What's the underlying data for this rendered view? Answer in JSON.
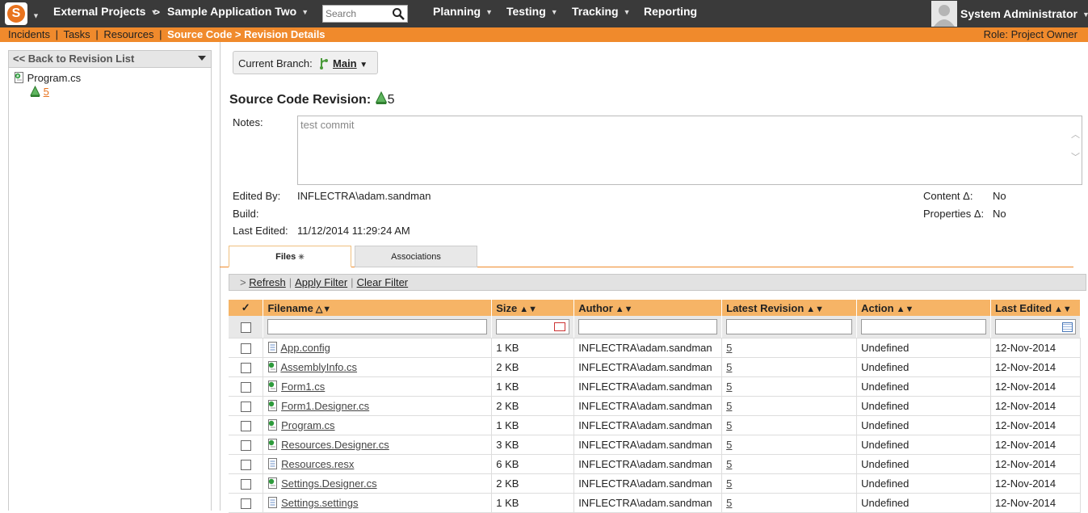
{
  "topnav": {
    "project_label": "External Projects",
    "separator": ">",
    "app_label": "Sample Application Two",
    "search_placeholder": "Search",
    "menus": [
      "Planning",
      "Testing",
      "Tracking",
      "Reporting"
    ],
    "user": "System Administrator"
  },
  "subnav": {
    "links": [
      "Incidents",
      "Tasks",
      "Resources"
    ],
    "current": "Source Code > Revision Details",
    "role": "Role: Project Owner"
  },
  "left": {
    "back_label": "<< Back to Revision List",
    "tree_file": "Program.cs",
    "tree_revision": "5"
  },
  "branch": {
    "label": "Current Branch:",
    "value": "Main"
  },
  "revision": {
    "heading": "Source Code Revision:",
    "number": "5",
    "notes_label": "Notes:",
    "notes_value": "test commit",
    "edited_by_label": "Edited By:",
    "edited_by_value": "INFLECTRA\\adam.sandman",
    "build_label": "Build:",
    "last_edited_label": "Last Edited:",
    "last_edited_value": "11/12/2014 11:29:24 AM",
    "content_delta_label": "Content Δ:",
    "content_delta_value": "No",
    "properties_delta_label": "Properties Δ:",
    "properties_delta_value": "No"
  },
  "tabs": {
    "files": "Files",
    "associations": "Associations"
  },
  "filterbar": {
    "arrow": ">",
    "refresh": "Refresh",
    "apply": "Apply Filter",
    "clear": "Clear Filter"
  },
  "grid": {
    "check_header": "✓",
    "columns": [
      "Filename",
      "Size",
      "Author",
      "Latest Revision",
      "Action",
      "Last Edited"
    ],
    "rows": [
      {
        "filename": "App.config",
        "size": "1 KB",
        "author": "INFLECTRA\\adam.sandman",
        "revision": "5",
        "action": "Undefined",
        "edited": "12-Nov-2014",
        "icon": "config"
      },
      {
        "filename": "AssemblyInfo.cs",
        "size": "2 KB",
        "author": "INFLECTRA\\adam.sandman",
        "revision": "5",
        "action": "Undefined",
        "edited": "12-Nov-2014",
        "icon": "cs"
      },
      {
        "filename": "Form1.cs",
        "size": "1 KB",
        "author": "INFLECTRA\\adam.sandman",
        "revision": "5",
        "action": "Undefined",
        "edited": "12-Nov-2014",
        "icon": "cs"
      },
      {
        "filename": "Form1.Designer.cs",
        "size": "2 KB",
        "author": "INFLECTRA\\adam.sandman",
        "revision": "5",
        "action": "Undefined",
        "edited": "12-Nov-2014",
        "icon": "cs"
      },
      {
        "filename": "Program.cs",
        "size": "1 KB",
        "author": "INFLECTRA\\adam.sandman",
        "revision": "5",
        "action": "Undefined",
        "edited": "12-Nov-2014",
        "icon": "cs"
      },
      {
        "filename": "Resources.Designer.cs",
        "size": "3 KB",
        "author": "INFLECTRA\\adam.sandman",
        "revision": "5",
        "action": "Undefined",
        "edited": "12-Nov-2014",
        "icon": "cs"
      },
      {
        "filename": "Resources.resx",
        "size": "6 KB",
        "author": "INFLECTRA\\adam.sandman",
        "revision": "5",
        "action": "Undefined",
        "edited": "12-Nov-2014",
        "icon": "config"
      },
      {
        "filename": "Settings.Designer.cs",
        "size": "2 KB",
        "author": "INFLECTRA\\adam.sandman",
        "revision": "5",
        "action": "Undefined",
        "edited": "12-Nov-2014",
        "icon": "cs"
      },
      {
        "filename": "Settings.settings",
        "size": "1 KB",
        "author": "INFLECTRA\\adam.sandman",
        "revision": "5",
        "action": "Undefined",
        "edited": "12-Nov-2014",
        "icon": "config"
      }
    ]
  },
  "colors": {
    "topbar": "#3a3a3a",
    "accent": "#f08a2c",
    "grid_header": "#f6b466"
  }
}
